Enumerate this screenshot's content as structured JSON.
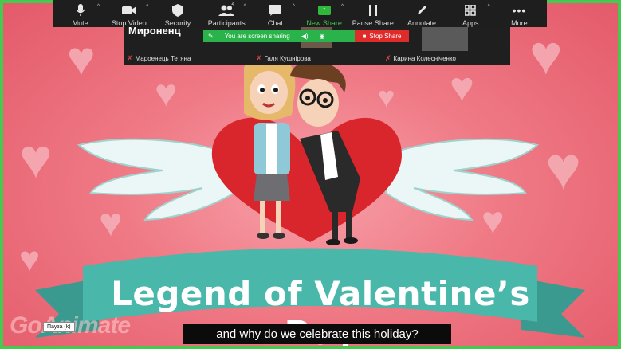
{
  "toolbar": {
    "items": [
      {
        "label": "Mute",
        "icon": "microphone-icon",
        "caret": true
      },
      {
        "label": "Stop Video",
        "icon": "video-camera-icon",
        "caret": true
      },
      {
        "label": "Security",
        "icon": "shield-icon",
        "caret": false
      },
      {
        "label": "Participants",
        "icon": "participants-icon",
        "caret": true,
        "count": "4"
      },
      {
        "label": "Chat",
        "icon": "chat-icon",
        "caret": true
      },
      {
        "label": "New Share",
        "icon": "share-arrow-icon",
        "caret": true
      },
      {
        "label": "Pause Share",
        "icon": "pause-icon",
        "caret": false
      },
      {
        "label": "Annotate",
        "icon": "pencil-icon",
        "caret": false
      },
      {
        "label": "Apps",
        "icon": "apps-icon",
        "caret": true
      },
      {
        "label": "More",
        "icon": "more-dots-icon",
        "caret": false
      }
    ]
  },
  "sharing": {
    "status": "You are screen sharing",
    "stop_label": "Stop Share"
  },
  "participants": [
    {
      "name": "Мароенець Тетяна",
      "tile_title": "Мироненц"
    },
    {
      "name": "Галя Кушнірова"
    },
    {
      "name": "Карина Колесніченко"
    }
  ],
  "video": {
    "title": "Legend of Valentine’s Day",
    "subtitle": "and why do we celebrate this holiday?",
    "pause_tooltip": "Пауза (k)",
    "watermark": "GoAnimate"
  },
  "colors": {
    "frame_border": "#45c94e",
    "toolbar_bg": "#1e1e1e",
    "share_green": "#2ab34a",
    "stop_red": "#e02b2b",
    "ribbon": "#49b7a9",
    "heart": "#d9262c"
  }
}
